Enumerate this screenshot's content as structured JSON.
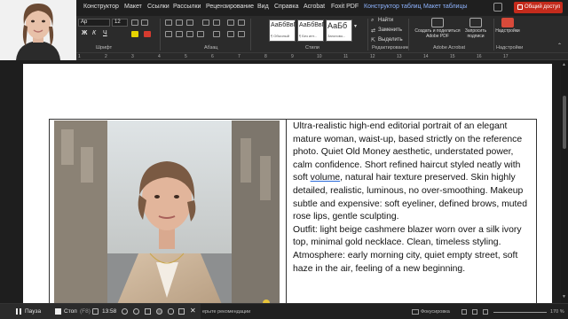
{
  "menu": {
    "items": [
      "Конструктор",
      "Макет",
      "Ссылки",
      "Рассылки",
      "Рецензирование",
      "Вид",
      "Справка",
      "Acrobat",
      "Foxit PDF",
      "Конструктор таблиц",
      "Макет таблицы"
    ],
    "share_label": "Общий доступ"
  },
  "ribbon": {
    "font_name": "Ар",
    "font_size": "12",
    "groups": [
      "Шрифт",
      "Абзац",
      "Стили",
      "Редактирование",
      "Adobe Acrobat",
      "Надстройки"
    ],
    "styles": [
      {
        "sample": "АаБбВвГ",
        "name": "¶ Обычный"
      },
      {
        "sample": "АаБбВвГ",
        "name": "¶ Без инт..."
      },
      {
        "sample": "АаБб",
        "name": "Заголово..."
      }
    ],
    "edit_items": [
      "Найти",
      "Заменить",
      "Выделить"
    ],
    "acrobat_buttons": [
      "Создать и поделиться Adobe PDF",
      "Запросить подписи"
    ],
    "addins_label": "Надстройки"
  },
  "ruler": {
    "numbers": [
      "1",
      "2",
      "3",
      "4",
      "5",
      "6",
      "7",
      "8",
      "9",
      "10",
      "11",
      "12",
      "13",
      "14",
      "15",
      "16",
      "17"
    ]
  },
  "document": {
    "paragraphs": [
      {
        "before": "Ultra-realistic high-end editorial portrait of an elegant mature woman, waist-up, based strictly on the reference photo. Quiet Old Money aesthetic, understated power, calm confidence. Short refined haircut styled neatly with soft ",
        "underlined": "volume",
        "after": ", natural hair texture preserved. Skin highly detailed, realistic, luminous, no over-smoothing. Makeup subtle and expensive: soft eyeliner, defined brows, muted rose lips, gentle sculpting."
      },
      {
        "before": "Outfit: light beige cashmere blazer worn over a silk ivory top, minimal gold necklace. Clean, timeless styling.",
        "underlined": "",
        "after": ""
      },
      {
        "before": "Atmosphere: early morning city, quiet empty street, soft haze in the air, feeling of a new beginning.",
        "underlined": "",
        "after": ""
      }
    ]
  },
  "recorder": {
    "pause_label": "Пауза",
    "stop_label": "Стоп",
    "stop_key": "(F8)",
    "time": "13:58"
  },
  "status": {
    "left_text": "ерыте рекомендации",
    "focus_label": "Фокусировка",
    "zoom_label": "170 %"
  },
  "colors": {
    "share_button": "#c42b1c",
    "context_tab": "#8fb4ff",
    "accent_dot": "#e9c53a"
  }
}
